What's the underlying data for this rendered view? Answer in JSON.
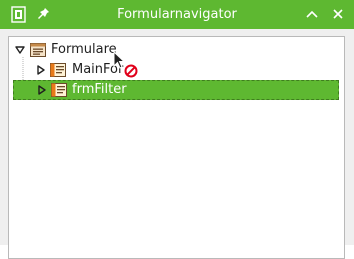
{
  "window": {
    "title": "Formularnavigator",
    "icons": {
      "app": "document-app-icon",
      "pin": "pin-icon",
      "collapse": "chevron-up-icon",
      "close": "close-icon"
    }
  },
  "tree": {
    "root": {
      "label": "Formulare",
      "expanded": true,
      "icon": "forms-folder-icon"
    },
    "children": [
      {
        "label": "MainForm",
        "display": "MainFor",
        "expanded": false,
        "icon": "form-icon",
        "selected": false
      },
      {
        "label": "frmFilter",
        "expanded": false,
        "icon": "form-icon",
        "selected": true
      }
    ]
  },
  "colors": {
    "accent": "#5eb831",
    "selection_border": "#3f7d1f",
    "no_drop": "#e0001a"
  }
}
